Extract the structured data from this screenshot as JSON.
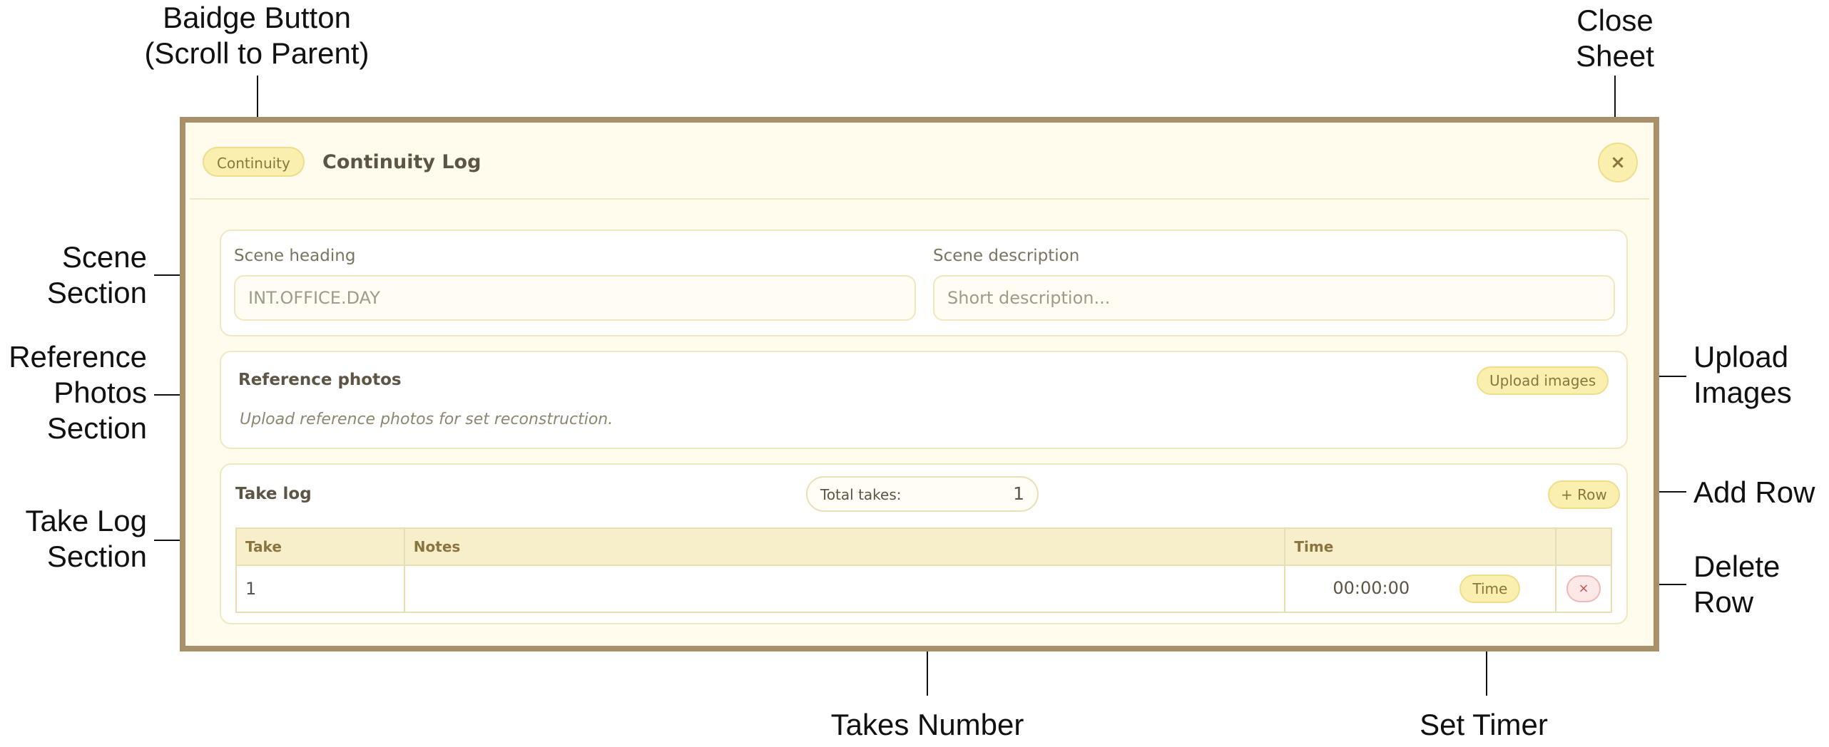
{
  "annotations": {
    "badge_button": "Baidge Button\n(Scroll to Parent)",
    "close_sheet": "Close\nSheet",
    "scene_section": "Scene\nSection",
    "reference_photos_section": "Reference\nPhotos\nSection",
    "take_log_section": "Take Log\nSection",
    "upload_images": "Upload\nImages",
    "add_row": "Add Row",
    "delete_row": "Delete\nRow",
    "takes_number": "Takes Number",
    "set_timer": "Set Timer"
  },
  "sheet": {
    "badge_label": "Continuity",
    "title": "Continuity Log",
    "close_icon": "close-icon",
    "close_glyph": "×"
  },
  "scene": {
    "heading_label": "Scene heading",
    "heading_placeholder": "INT.OFFICE.DAY",
    "heading_value": "",
    "description_label": "Scene description",
    "description_placeholder": "Short description...",
    "description_value": ""
  },
  "photos": {
    "title": "Reference photos",
    "upload_label": "Upload images",
    "hint": "Upload reference photos for set reconstruction."
  },
  "take_log": {
    "title": "Take log",
    "total_label": "Total takes:",
    "total_value": "1",
    "add_row_label": "+ Row",
    "columns": [
      "Take",
      "Notes",
      "Time",
      ""
    ],
    "rows": [
      {
        "take": "1",
        "notes": "",
        "time": "00:00:00",
        "time_button": "Time",
        "delete_glyph": "×"
      }
    ]
  },
  "colors": {
    "sheet_border": "#a8906a",
    "sheet_bg": "#fffbea",
    "pill_bg": "#fbefb0",
    "pill_border": "#eedd8a",
    "accent_text": "#8a7440",
    "delete_bg": "#fde8e8",
    "delete_text": "#c25555"
  }
}
